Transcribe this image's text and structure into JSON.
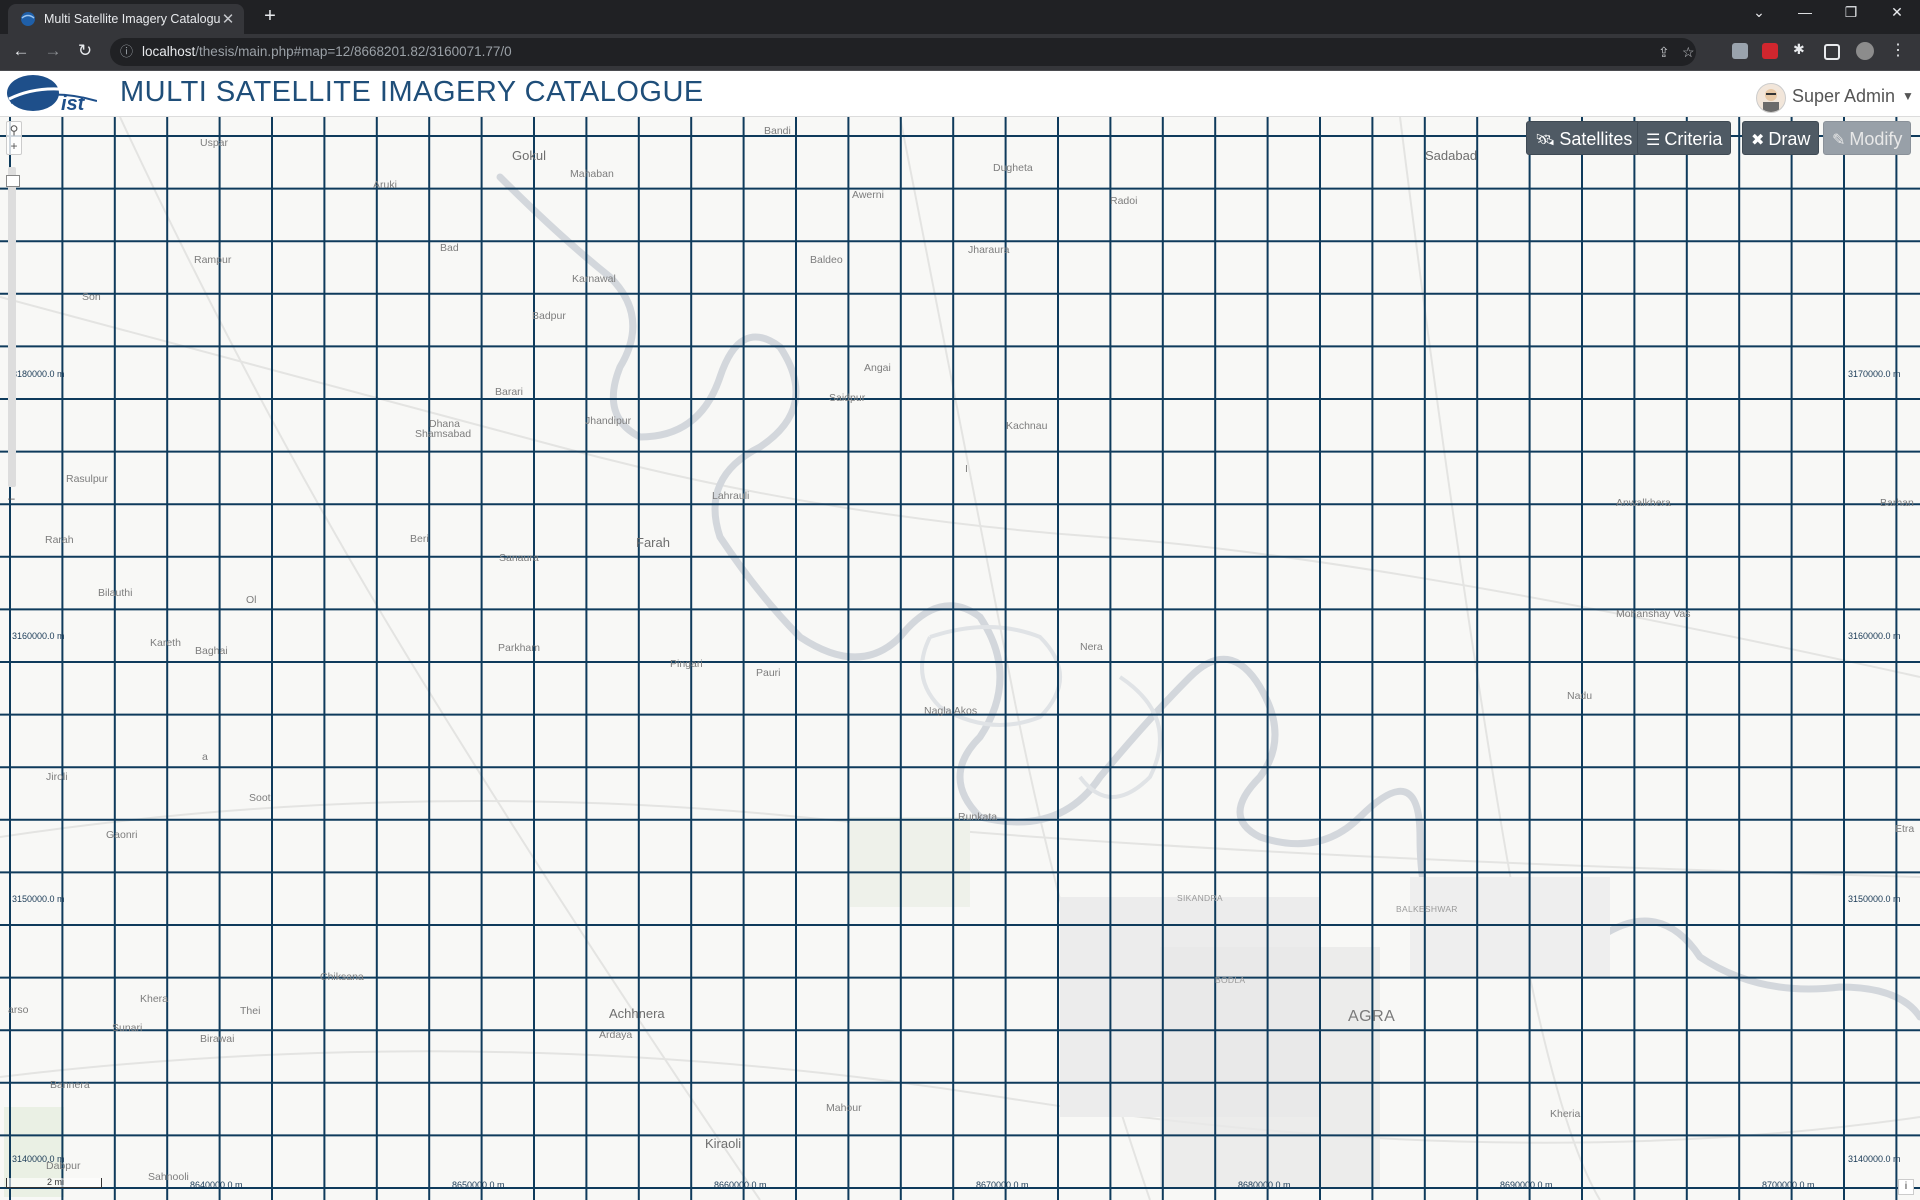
{
  "browser": {
    "tab_title": "Multi Satellite Imagery Catalogue",
    "url_host": "localhost",
    "url_path": "/thesis/main.php#map=12/8668201.82/3160071.77/0",
    "new_tab_icon": "plus-icon"
  },
  "app": {
    "logo_text": "ist",
    "title": "MULTI SATELLITE IMAGERY CATALOGUE",
    "user_name": "Super Admin"
  },
  "map_controls": {
    "zoom_in": "+",
    "zoom_out": "–",
    "satellites_label": "Satellites",
    "criteria_label": "Criteria",
    "draw_label": "Draw",
    "modify_label": "Modify",
    "scale_label": "2 mi",
    "attribution": "i"
  },
  "colors": {
    "grid_line": "#0f3b5c",
    "title": "#1f4e79",
    "button_bg": "#4f5a64",
    "button_disabled": "#98a0a8"
  },
  "grid_labels": {
    "left": [
      "3180000.0 m",
      "3160000.0 m",
      "3140000.0 m"
    ],
    "right": [
      "3170000.0 m",
      "3160000.0 m",
      "3150000.0 m",
      "3140000.0 m"
    ],
    "left_mid": "3150000.0 m",
    "bottom": [
      "8640000.0 m",
      "8650000.0 m",
      "8660000.0 m",
      "8670000.0 m",
      "8680000.0 m",
      "8690000.0 m",
      "8700000.0 m"
    ]
  },
  "places": [
    {
      "name": "Uspar",
      "cls": ""
    },
    {
      "name": "Gokul",
      "cls": "big"
    },
    {
      "name": "Bandi",
      "cls": ""
    },
    {
      "name": "Mahaban",
      "cls": ""
    },
    {
      "name": "Aruki",
      "cls": ""
    },
    {
      "name": "Awerni",
      "cls": ""
    },
    {
      "name": "Dugheta",
      "cls": ""
    },
    {
      "name": "Radoi",
      "cls": ""
    },
    {
      "name": "Sadabad",
      "cls": "big"
    },
    {
      "name": "Rampur",
      "cls": ""
    },
    {
      "name": "Bad",
      "cls": ""
    },
    {
      "name": "Baldeo",
      "cls": ""
    },
    {
      "name": "Jharaura",
      "cls": ""
    },
    {
      "name": "Karnawal",
      "cls": ""
    },
    {
      "name": "Son",
      "cls": ""
    },
    {
      "name": "Badpur",
      "cls": ""
    },
    {
      "name": "Angai",
      "cls": ""
    },
    {
      "name": "Saidpur",
      "cls": ""
    },
    {
      "name": "Barari",
      "cls": ""
    },
    {
      "name": "Jhandipur",
      "cls": ""
    },
    {
      "name": "Dhana",
      "cls": ""
    },
    {
      "name": "Shamsabad",
      "cls": ""
    },
    {
      "name": "Kachnau",
      "cls": ""
    },
    {
      "name": "Rasulpur",
      "cls": ""
    },
    {
      "name": "Lahrauli",
      "cls": ""
    },
    {
      "name": "Anwalkhera",
      "cls": ""
    },
    {
      "name": "Barhan",
      "cls": ""
    },
    {
      "name": "Rarah",
      "cls": ""
    },
    {
      "name": "Beri",
      "cls": ""
    },
    {
      "name": "Farah",
      "cls": "big"
    },
    {
      "name": "Sanaura",
      "cls": ""
    },
    {
      "name": "Bilauthi",
      "cls": ""
    },
    {
      "name": "Ol",
      "cls": ""
    },
    {
      "name": "Mohanshay Vas",
      "cls": ""
    },
    {
      "name": "Kareth",
      "cls": ""
    },
    {
      "name": "Baghai",
      "cls": ""
    },
    {
      "name": "Parkham",
      "cls": ""
    },
    {
      "name": "Pingari",
      "cls": ""
    },
    {
      "name": "Pauri",
      "cls": ""
    },
    {
      "name": "Nera",
      "cls": ""
    },
    {
      "name": "Nadu",
      "cls": ""
    },
    {
      "name": "Nagla Akos",
      "cls": ""
    },
    {
      "name": "Jiroli",
      "cls": ""
    },
    {
      "name": "Soot",
      "cls": ""
    },
    {
      "name": "a",
      "cls": ""
    },
    {
      "name": "Gaonri",
      "cls": ""
    },
    {
      "name": "Runkata",
      "cls": ""
    },
    {
      "name": "Etra",
      "cls": ""
    },
    {
      "name": "SIKANDRA",
      "cls": "sm"
    },
    {
      "name": "BALKESHWAR",
      "cls": "sm"
    },
    {
      "name": "Chiksana",
      "cls": ""
    },
    {
      "name": "BODLA",
      "cls": "sm"
    },
    {
      "name": "Khera",
      "cls": ""
    },
    {
      "name": "Thei",
      "cls": ""
    },
    {
      "name": "Achhnera",
      "cls": "big"
    },
    {
      "name": "AGRA",
      "cls": "city"
    },
    {
      "name": "Sunari",
      "cls": ""
    },
    {
      "name": "Birawai",
      "cls": ""
    },
    {
      "name": "Ardaya",
      "cls": ""
    },
    {
      "name": "arso",
      "cls": ""
    },
    {
      "name": "Bannera",
      "cls": ""
    },
    {
      "name": "Mahour",
      "cls": ""
    },
    {
      "name": "Kiraoli",
      "cls": "big"
    },
    {
      "name": "Kheria",
      "cls": ""
    },
    {
      "name": "Dabpur",
      "cls": ""
    },
    {
      "name": "Sahnooli",
      "cls": ""
    },
    {
      "name": "I",
      "cls": ""
    }
  ]
}
